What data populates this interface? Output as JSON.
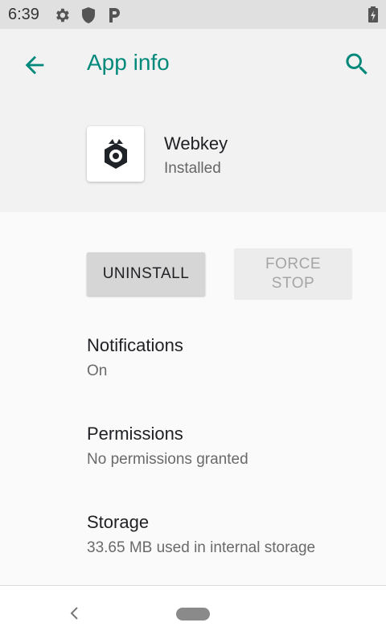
{
  "status_bar": {
    "time": "6:39",
    "icons": [
      "gear-icon",
      "shield-icon",
      "parking-icon"
    ],
    "battery_icon": "battery-charging-icon"
  },
  "header": {
    "title": "App info",
    "back_icon": "arrow-back-icon",
    "search_icon": "search-icon"
  },
  "app": {
    "name": "Webkey",
    "status": "Installed"
  },
  "actions": {
    "uninstall_label": "UNINSTALL",
    "force_stop_label": "FORCE\nSTOP"
  },
  "settings": [
    {
      "title": "Notifications",
      "subtitle": "On"
    },
    {
      "title": "Permissions",
      "subtitle": "No permissions granted"
    },
    {
      "title": "Storage",
      "subtitle": "33.65 MB used in internal storage"
    }
  ],
  "colors": {
    "accent": "#00897b",
    "header_bg": "#f2f2f2",
    "status_bar_bg": "#e0e0e0"
  }
}
